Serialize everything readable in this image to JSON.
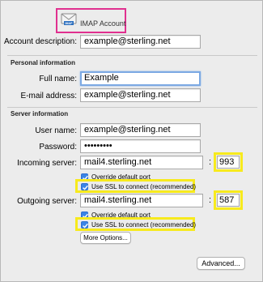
{
  "header": {
    "account_type": "IMAP Account"
  },
  "account": {
    "description_label": "Account description:",
    "description_value": "example@sterling.net"
  },
  "personal": {
    "section_title": "Personal information",
    "full_name_label": "Full name:",
    "full_name_value": "Example",
    "email_label": "E-mail address:",
    "email_value": "example@sterling.net"
  },
  "server": {
    "section_title": "Server information",
    "username_label": "User name:",
    "username_value": "example@sterling.net",
    "password_label": "Password:",
    "password_value": "•••••••••",
    "incoming_label": "Incoming server:",
    "incoming_value": "mail4.sterling.net",
    "incoming_port": "993",
    "incoming_override_label": "Override default port",
    "incoming_ssl_label": "Use SSL to connect (recommended)",
    "outgoing_label": "Outgoing server:",
    "outgoing_value": "mail4.sterling.net",
    "outgoing_port": "587",
    "outgoing_override_label": "Override default port",
    "outgoing_ssl_label": "Use SSL to connect (recommended)",
    "colon": ":"
  },
  "buttons": {
    "more_options": "More Options...",
    "advanced": "Advanced..."
  },
  "colors": {
    "highlight_yellow": "#f7ea1d",
    "highlight_pink": "#e0308f",
    "checkbox_blue": "#3b84e6",
    "focus_ring": "#7ca9e3"
  },
  "icons": {
    "account": "mail-envelope-icon",
    "checkbox": "checkmark-icon"
  }
}
